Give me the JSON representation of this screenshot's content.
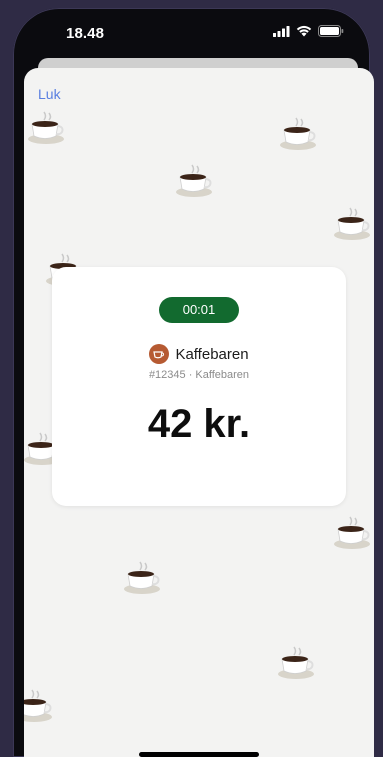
{
  "status_bar": {
    "time": "18.48",
    "icons": [
      "cellular-signal-icon",
      "wifi-icon",
      "battery-icon"
    ]
  },
  "header": {
    "close_label": "Luk"
  },
  "order_card": {
    "timer": "00:01",
    "merchant_name": "Kaffebaren",
    "merchant_icon": "coffee-cup-icon",
    "order_info": "#12345 · Kaffebaren",
    "amount": "42 kr."
  },
  "colors": {
    "page_background": "#2f2b45",
    "screen_background": "#f3f3f2",
    "timer_background": "#126a2f",
    "link": "#5a7fe0",
    "merchant_avatar": "#b65a32"
  }
}
